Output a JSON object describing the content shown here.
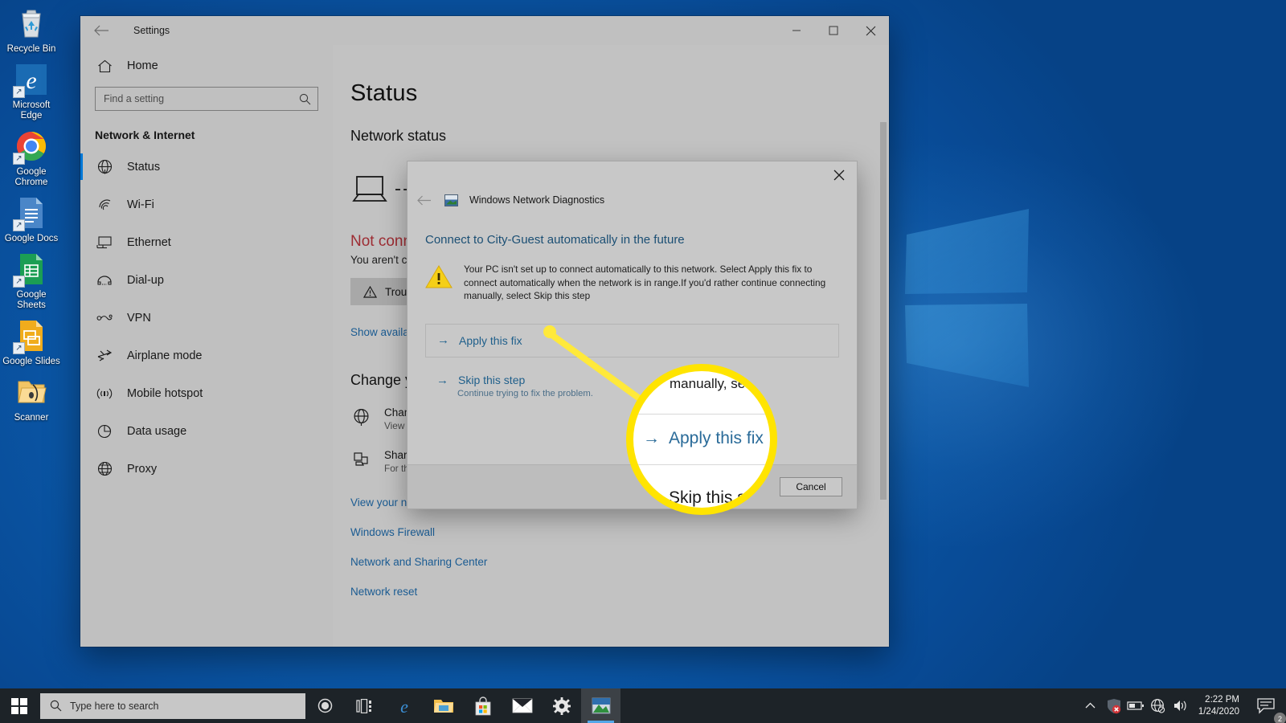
{
  "desktop": {
    "icons": [
      {
        "name": "recycle-bin",
        "label": "Recycle Bin"
      },
      {
        "name": "microsoft-edge",
        "label": "Microsoft Edge"
      },
      {
        "name": "google-chrome",
        "label": "Google Chrome"
      },
      {
        "name": "google-docs",
        "label": "Google Docs"
      },
      {
        "name": "google-sheets",
        "label": "Google Sheets"
      },
      {
        "name": "google-slides",
        "label": "Google Slides"
      },
      {
        "name": "scanner",
        "label": "Scanner"
      }
    ]
  },
  "settings_window": {
    "title": "Settings",
    "back_icon": "back-arrow-icon",
    "minimize_icon": "minimize-icon",
    "maximize_icon": "maximize-icon",
    "close_icon": "close-icon",
    "sidebar": {
      "home_label": "Home",
      "home_icon": "home-icon",
      "search_placeholder": "Find a setting",
      "search_value": "",
      "search_icon": "search-icon",
      "heading": "Network & Internet",
      "items": [
        {
          "label": "Status",
          "icon": "globe-icon",
          "selected": true
        },
        {
          "label": "Wi-Fi",
          "icon": "wifi-icon",
          "selected": false
        },
        {
          "label": "Ethernet",
          "icon": "ethernet-icon",
          "selected": false
        },
        {
          "label": "Dial-up",
          "icon": "dialup-icon",
          "selected": false
        },
        {
          "label": "VPN",
          "icon": "vpn-icon",
          "selected": false
        },
        {
          "label": "Airplane mode",
          "icon": "airplane-icon",
          "selected": false
        },
        {
          "label": "Mobile hotspot",
          "icon": "hotspot-icon",
          "selected": false
        },
        {
          "label": "Data usage",
          "icon": "data-usage-icon",
          "selected": false
        },
        {
          "label": "Proxy",
          "icon": "proxy-globe-icon",
          "selected": false
        }
      ]
    },
    "main": {
      "page_title": "Status",
      "network_status_heading": "Network status",
      "not_connected": "Not connected",
      "not_connected_sub": "You aren't connected to any networks.",
      "troubleshoot_label": "Troubleshoot",
      "troubleshoot_icon": "warning-triangle-icon",
      "show_available": "Show available networks",
      "change_heading": "Change your network settings",
      "settings_rows": [
        {
          "icon": "globe-icon",
          "title": "Change adapter options",
          "subtitle": "View network adapters and change connection settings."
        },
        {
          "icon": "sharing-icon",
          "title": "Sharing options",
          "subtitle": "For the networks you connect to, decide what you want to share."
        }
      ],
      "links": [
        "View your network properties",
        "Windows Firewall",
        "Network and Sharing Center",
        "Network reset"
      ]
    }
  },
  "diagnostics_dialog": {
    "app_title": "Windows Network Diagnostics",
    "app_icon": "network-diagnostics-icon",
    "back_icon": "back-arrow-icon",
    "close_icon": "close-icon",
    "question": "Connect to City-Guest automatically in the future",
    "warning_icon": "warning-triangle-icon",
    "warning_text": "Your PC isn't set up to connect automatically to this network. Select Apply this fix to connect automatically when the network is in range.If you'd rather continue connecting manually, select Skip this step",
    "apply_fix_label": "Apply this fix",
    "apply_fix_arrow": "→",
    "skip_step_label": "Skip this step",
    "skip_step_sub": "Continue trying to fix the problem.",
    "cancel_label": "Cancel"
  },
  "callout": {
    "zoom_text_top": "manually, se",
    "zoom_apply_label": "Apply this fix",
    "zoom_apply_arrow": "→",
    "zoom_skip_label": "Skip this st",
    "highlight_color": "#ffe400"
  },
  "taskbar": {
    "start_icon": "windows-start-icon",
    "search_placeholder": "Type here to search",
    "search_icon": "search-icon",
    "buttons": [
      {
        "name": "cortana-icon",
        "active": false
      },
      {
        "name": "task-view-icon",
        "active": false
      },
      {
        "name": "microsoft-edge-icon",
        "active": false
      },
      {
        "name": "file-explorer-icon",
        "active": false
      },
      {
        "name": "microsoft-store-icon",
        "active": false
      },
      {
        "name": "mail-icon",
        "active": false
      },
      {
        "name": "settings-gear-icon",
        "active": false
      },
      {
        "name": "network-diagnostics-icon",
        "active": true
      }
    ],
    "tray": [
      {
        "name": "show-hidden-icons-chevron"
      },
      {
        "name": "security-alert-icon"
      },
      {
        "name": "battery-icon"
      },
      {
        "name": "network-disconnected-icon"
      },
      {
        "name": "volume-icon"
      }
    ],
    "time": "2:22 PM",
    "date": "1/24/2020",
    "notification_count": "2",
    "action_center_icon": "action-center-icon"
  }
}
